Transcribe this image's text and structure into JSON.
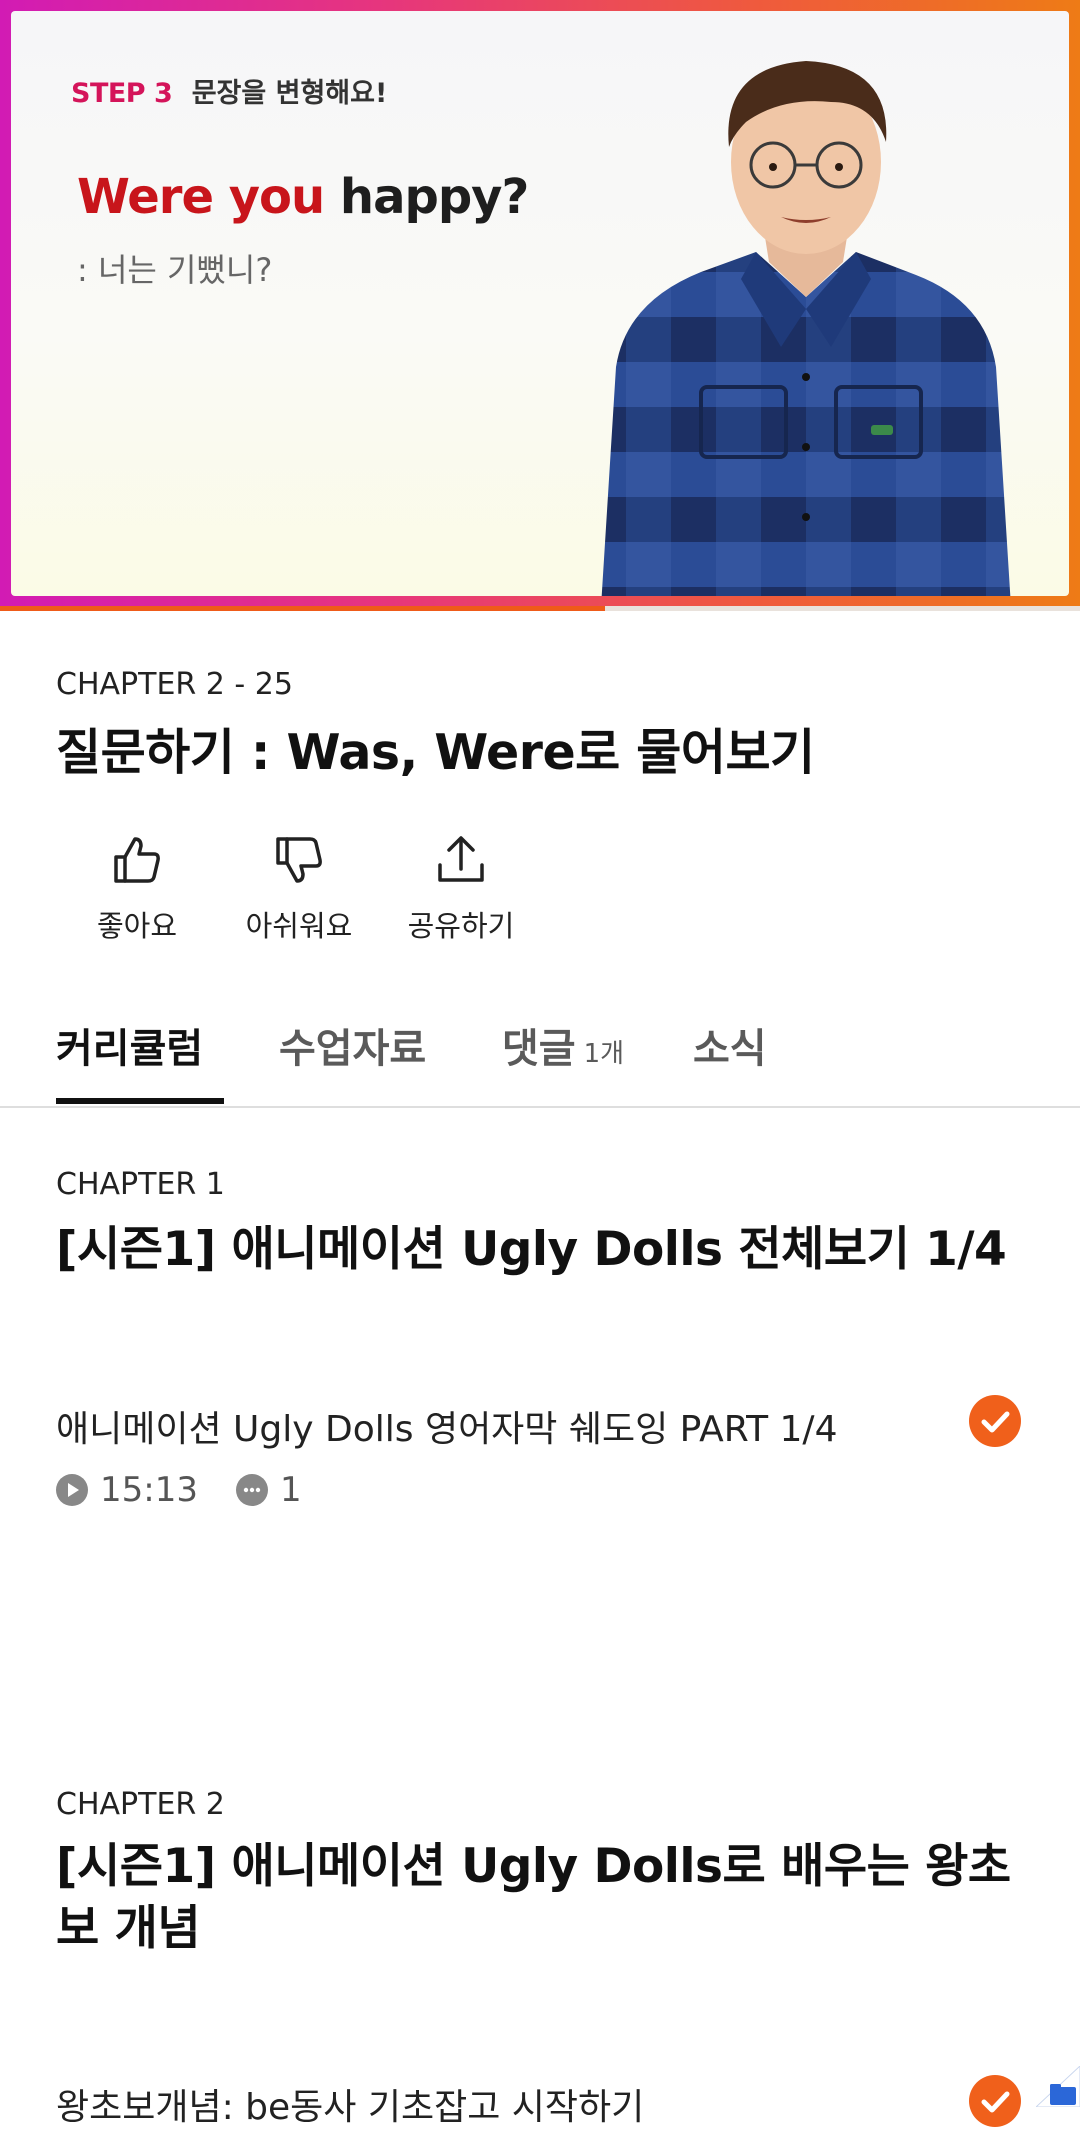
{
  "video": {
    "step_label": "STEP 3",
    "step_text": "문장을 변형해요!",
    "phrase_red": "Were you",
    "phrase_dark": "happy?",
    "translation": ": 너는 기뻤니?",
    "progress_fraction": 0.56,
    "colors": {
      "accent": "#ef5b19",
      "phrase_red": "#c8151b",
      "step_pink": "#d4145a"
    }
  },
  "lecture": {
    "chapter_label": "CHAPTER 2 - 25",
    "title": "질문하기 : Was, Were로 물어보기"
  },
  "actions": [
    {
      "label": "좋아요",
      "icon": "thumbs-up-icon"
    },
    {
      "label": "아쉬워요",
      "icon": "thumbs-down-icon"
    },
    {
      "label": "공유하기",
      "icon": "share-icon"
    }
  ],
  "tabs": [
    {
      "label": "커리큘럼",
      "active": true
    },
    {
      "label": "수업자료"
    },
    {
      "label": "댓글",
      "count": "1개"
    },
    {
      "label": "소식"
    }
  ],
  "curriculum": [
    {
      "chapter_label": "CHAPTER 1",
      "title": "[시즌1] 애니메이션 Ugly Dolls 전체보기 1/4",
      "lessons": [
        {
          "title": "애니메이션 Ugly Dolls 영어자막 쉐도잉 PART 1/4",
          "duration": "15:13",
          "comments": "1",
          "completed": true
        }
      ]
    },
    {
      "chapter_label": "CHAPTER 2",
      "title": "[시즌1] 애니메이션 Ugly Dolls로 배우는 왕초보 개념",
      "lessons": [
        {
          "title": "왕초보개념: be동사 기초잡고 시작하기",
          "completed": true
        }
      ]
    }
  ]
}
